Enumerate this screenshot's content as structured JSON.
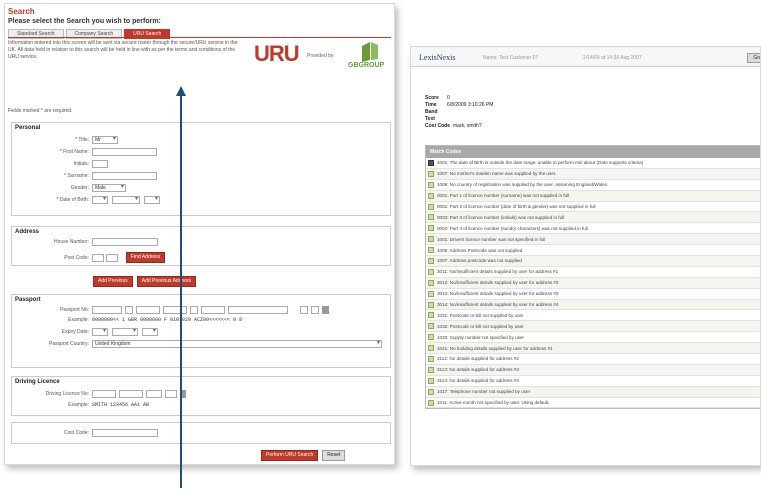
{
  "left": {
    "title": "Search",
    "prompt": "Please select the Search you wish to perform:",
    "tabs": [
      {
        "label": "Standard Search",
        "active": false
      },
      {
        "label": "Company Search",
        "active": false
      },
      {
        "label": "URU Search",
        "active": true
      }
    ],
    "info_text": "Information entered into this screen will be sent via secure router through the secure/URU service in the UK. All data held in relation to this search will be held in line with as per the terms and conditions of the URU service.",
    "logo_uru": "URU",
    "provided_by": "Provided by",
    "gb_logo_text": "GBGROUP",
    "required_note": "Fields marked * are required.",
    "personal": {
      "heading": "Personal",
      "title_label": "* Title:",
      "title_value": "Mr",
      "first_name_label": "* First Name:",
      "initials_label": "Initials:",
      "surname_label": "* Surname:",
      "gender_label": "Gender:",
      "gender_value": "Male",
      "dob_label": "* Date of Birth:"
    },
    "address": {
      "heading": "Address",
      "house_number_label": "House Number:",
      "post_code_label": "Post Code:",
      "find_address_button": "Find Address",
      "add_current_button": "Add Previous",
      "add_previous_button": "Add Previous Address"
    },
    "passport": {
      "heading": "Passport",
      "number_label": "Passport No:",
      "example_label": "Example:",
      "example_value": "0000000<<  1  GBR  0000000  F  0101020  ACZ00<<<<<<<  0  0",
      "expiry_label": "Expiry Date:",
      "country_label": "Passport Country:",
      "country_value": "United Kingdom"
    },
    "driving": {
      "heading": "Driving Licence",
      "number_label": "Driving Licence No:",
      "example_label": "Example:",
      "example_value": "SMITH 123456 AA1 AB"
    },
    "cost_code_label": "Cost Code:",
    "perform_button": "Perform URU Search",
    "reset_button": "Reset"
  },
  "right": {
    "logo": "LexisNexis",
    "header_items": [
      "Name: Test Customer 07",
      "2/14/09 at 14:39 Aug 2007"
    ],
    "header_button": "Go",
    "meta": [
      {
        "label": "Score",
        "value": "0"
      },
      {
        "label": "Time",
        "value": "6/8/2009 3:10:26 PM"
      },
      {
        "label": "Band Text",
        "value": ""
      },
      {
        "label": "Cost Code",
        "value": "mark, smith?"
      }
    ],
    "table_title": "Match Codes",
    "rows": [
      "4001: The date of Birth is outside the date range; unable to perform min about (Date supports criteria)",
      "1007: No mother's maiden name was supplied by the user.",
      "1009: No country of registration was supplied by the user, assuming England/Wales.",
      "0001: Part 1 of licence number (surname) was not supplied in full",
      "0002: Part 2 of licence number (date of birth & gender) was not supplied in full",
      "0003: Part 3 of licence number (initials) was not supplied in full",
      "0004: Part 4 of licence number (sundry characters) was not supplied in full",
      "1001: Drivers licence number was not specified in full",
      "1005: Address Postcode was not supplied",
      "1007: Address postcode was not supplied",
      "3011: No/insufficient details supplied by user for address #1",
      "3012: No/insufficient details supplied by user for address #2",
      "3013: No/insufficient details supplied by user for address #3",
      "3014: No/insufficient details supplied by user for address #4",
      "1031: Postcode or bill not supplied by user",
      "1032: Postcode or bill not supplied by user",
      "1020: Supply number not specified by user",
      "1041: No building details supplied by user for address #1",
      "3112: No details supplied for address #2",
      "3113: No details supplied for address #3",
      "3114: No details supplied for address #4",
      "1017: Telephone number not supplied by user",
      "1011: Active month not specified by user. Using default."
    ]
  }
}
